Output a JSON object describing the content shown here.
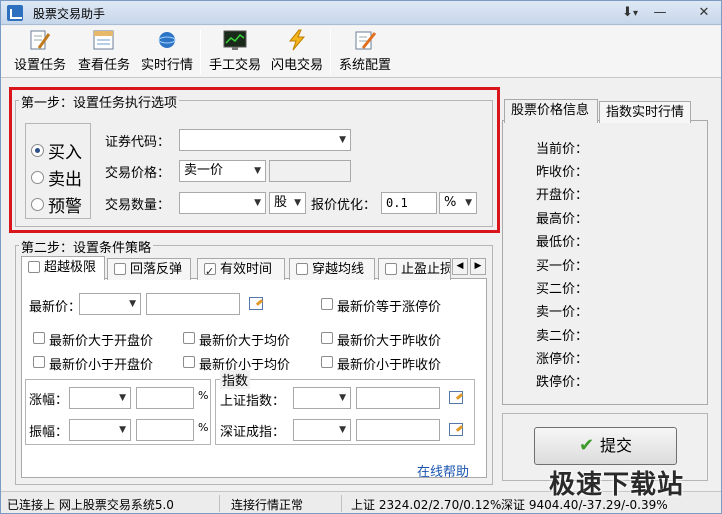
{
  "window": {
    "title": "股票交易助手"
  },
  "toolbar": {
    "items": [
      {
        "label": "设置任务"
      },
      {
        "label": "查看任务"
      },
      {
        "label": "实时行情"
      },
      {
        "label": "手工交易"
      },
      {
        "label": "闪电交易"
      },
      {
        "label": "系统配置"
      }
    ]
  },
  "step1": {
    "title": "第一步：设置任务执行选项",
    "actions": [
      {
        "label": "买入",
        "selected": true
      },
      {
        "label": "卖出",
        "selected": false
      },
      {
        "label": "预警",
        "selected": false
      }
    ],
    "code_label": "证券代码：",
    "code_value": "",
    "price_label": "交易价格：",
    "price_value": "卖一价",
    "qty_label": "交易数量：",
    "qty_value": "",
    "unit_value": "股",
    "optimize_label": "报价优化：",
    "optimize_value": "0.1",
    "optimize_unit": "%"
  },
  "step2": {
    "title": "第二步：设置条件策略",
    "tabs": [
      {
        "label": "超越极限",
        "checked": false,
        "active": true
      },
      {
        "label": "回落反弹",
        "checked": false
      },
      {
        "label": "有效时间",
        "checked": true
      },
      {
        "label": "穿越均线",
        "checked": false
      },
      {
        "label": "止盈止损",
        "checked": false
      }
    ],
    "latest_price_label": "最新价：",
    "checks": {
      "eq_limit_up": "最新价等于涨停价",
      "gt_open": "最新价大于开盘价",
      "gt_avg": "最新价大于均价",
      "gt_prevclose": "最新价大于昨收价",
      "lt_open": "最新价小于开盘价",
      "lt_avg": "最新价小于均价",
      "lt_prevclose": "最新价小于昨收价"
    },
    "index_group": "指数",
    "rise_label": "涨幅：",
    "amp_label": "振幅：",
    "percent": "%",
    "sh_index_label": "上证指数：",
    "sz_index_label": "深证成指：",
    "help_link": "在线帮助"
  },
  "right_panel": {
    "tabs": [
      "股票价格信息",
      "指数实时行情"
    ],
    "fields": [
      "当前价：",
      "昨收价：",
      "开盘价：",
      "最高价：",
      "最低价：",
      "买一价：",
      "买二价：",
      "卖一价：",
      "卖二价：",
      "涨停价：",
      "跌停价："
    ],
    "submit": "提交"
  },
  "status": {
    "connection": "已连接上 网上股票交易系统5.0",
    "quote": "连接行情正常",
    "sh": "上证 2324.02/2.70/0.12%",
    "sz": "深证 9404.40/-37.29/-0.39%"
  },
  "watermark": "极速下载站",
  "colors": {
    "highlight": "#d9141b",
    "link": "#1a55b0",
    "accent": "#2f6fbf"
  }
}
